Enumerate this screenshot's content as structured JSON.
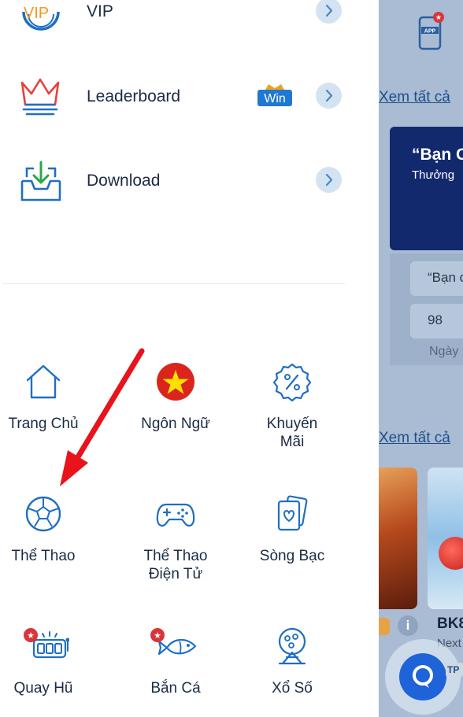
{
  "drawer": {
    "menu_rows": [
      {
        "id": "vip",
        "label": "VIP",
        "icon": "vip-icon"
      },
      {
        "id": "leaderboard",
        "label": "Leaderboard",
        "icon": "crown-icon",
        "badge": "Win"
      },
      {
        "id": "download",
        "label": "Download",
        "icon": "download-tray-icon"
      }
    ],
    "grid": [
      {
        "id": "home",
        "label": "Trang Chủ",
        "label2": "",
        "icon": "home-icon"
      },
      {
        "id": "language",
        "label": "Ngôn Ngữ",
        "label2": "",
        "icon": "vietnam-flag-icon"
      },
      {
        "id": "promotions",
        "label": "Khuyến",
        "label2": "Mãi",
        "icon": "percent-badge-icon"
      },
      {
        "id": "sports",
        "label": "Thể Thao",
        "label2": "",
        "icon": "soccer-ball-icon"
      },
      {
        "id": "esports",
        "label": "Thể Thao",
        "label2": "Điện Tử",
        "icon": "gamepad-icon"
      },
      {
        "id": "casino",
        "label": "Sòng Bạc",
        "label2": "",
        "icon": "playing-cards-icon"
      },
      {
        "id": "slots",
        "label": "Quay Hũ",
        "label2": "",
        "icon": "slot-machine-icon"
      },
      {
        "id": "fishing",
        "label": "Bắn Cá",
        "label2": "",
        "icon": "fish-icon"
      },
      {
        "id": "lottery",
        "label": "Xổ Số",
        "label2": "",
        "icon": "lottery-machine-icon"
      }
    ]
  },
  "background": {
    "app_icon_label": "APP",
    "see_all_1": "Xem tất cả",
    "see_all_2": "Xem tất cả",
    "banner_title": "“Bạn C",
    "banner_sub": "Thưởng",
    "pill_1": "“Bạn c",
    "pill_2": "98",
    "day_label": "Ngày",
    "game_name": "BK8",
    "game_sub": "Next",
    "info_label": "i",
    "chat_badge": "TP"
  },
  "colors": {
    "accent_blue": "#1f6fc2",
    "arrow_red": "#e8131b",
    "flag_red": "#da251d",
    "flag_star": "#ffdf00"
  }
}
